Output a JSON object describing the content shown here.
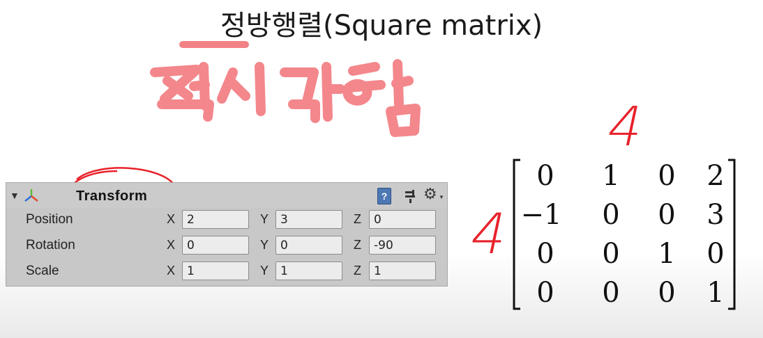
{
  "title": "정방행렬(Square matrix)",
  "handwriting": {
    "korean_note": "정사각형",
    "rows_label": "4",
    "cols_label": "4"
  },
  "inspector": {
    "component": "Transform",
    "help_icon_text": "?",
    "rows": [
      {
        "label": "Position",
        "x": "2",
        "y": "3",
        "z": "0"
      },
      {
        "label": "Rotation",
        "x": "0",
        "y": "0",
        "z": "-90"
      },
      {
        "label": "Scale",
        "x": "1",
        "y": "1",
        "z": "1"
      }
    ],
    "axes": {
      "x": "X",
      "y": "Y",
      "z": "Z"
    }
  },
  "matrix": [
    [
      "0",
      "1",
      "0",
      "2"
    ],
    [
      "−1",
      "0",
      "0",
      "3"
    ],
    [
      "0",
      "0",
      "1",
      "0"
    ],
    [
      "0",
      "0",
      "0",
      "1"
    ]
  ],
  "colors": {
    "ink": "#e8212a",
    "inspector_bg": "#c8c8c8",
    "field_bg": "#ececec"
  },
  "icons": [
    "fold-arrow-icon",
    "transform-axis-icon",
    "help-icon",
    "preset-icon",
    "gear-icon"
  ]
}
